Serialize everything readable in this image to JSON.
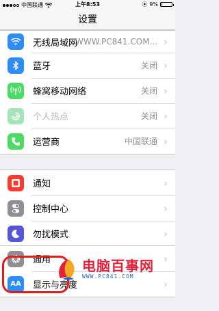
{
  "status_bar": {
    "carrier": "中国联通",
    "time": "上午8:53",
    "battery": "9%",
    "battery_level": 0.09
  },
  "nav": {
    "title": "设置"
  },
  "group1": [
    {
      "key": "wlan",
      "label": "无线局域网",
      "value": "WWW.PC841.COM...",
      "icon": "wifi-icon",
      "color": "#2d8cf5"
    },
    {
      "key": "bluetooth",
      "label": "蓝牙",
      "value": "关闭",
      "icon": "bluetooth-icon",
      "color": "#2d8cf5"
    },
    {
      "key": "cellular",
      "label": "蜂窝移动网络",
      "value": "关闭",
      "icon": "antenna-icon",
      "color": "#4cd964"
    },
    {
      "key": "hotspot",
      "label": "个人热点",
      "value": "关闭",
      "icon": "link-icon",
      "color": "#a6e3b8"
    },
    {
      "key": "carrier",
      "label": "运营商",
      "value": "中国联通",
      "icon": "phone-icon",
      "color": "#4cd964"
    }
  ],
  "group2": [
    {
      "key": "notifications",
      "label": "通知",
      "icon": "notification-icon",
      "color": "#ff3b30"
    },
    {
      "key": "control_center",
      "label": "控制中心",
      "icon": "toggles-icon",
      "color": "#8e8e93"
    },
    {
      "key": "dnd",
      "label": "勿扰模式",
      "icon": "moon-icon",
      "color": "#5856d6"
    }
  ],
  "group3": [
    {
      "key": "general",
      "label": "通用",
      "icon": "gear-icon",
      "color": "#8e8e93"
    },
    {
      "key": "display",
      "label": "显示与亮度",
      "icon": "text-size-icon",
      "color": "#2d8cf5"
    }
  ],
  "watermark": {
    "main": "电脑百事网",
    "sub": "WWW.PC841.COM"
  }
}
